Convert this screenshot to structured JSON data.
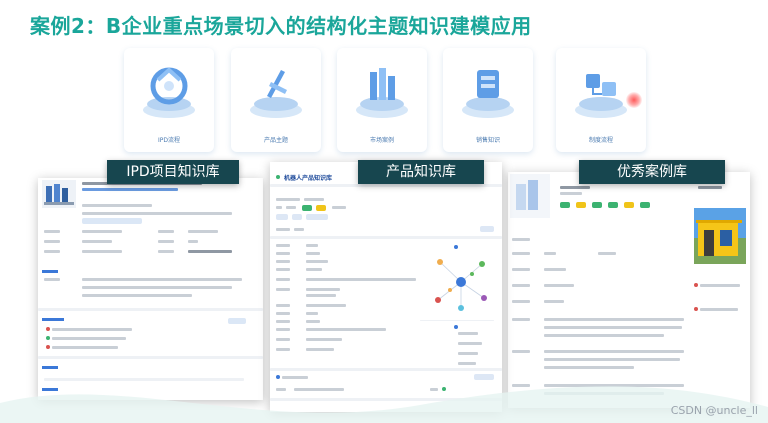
{
  "slide": {
    "title": "案例2：B企业重点场景切入的结构化主题知识建模应用"
  },
  "categories": [
    {
      "label": "IPD流程"
    },
    {
      "label": "产品主题"
    },
    {
      "label": "市场案例"
    },
    {
      "label": "销售知识"
    },
    {
      "label": "制度流程"
    }
  ],
  "banners": {
    "ipd": "IPD项目知识库",
    "product": "产品知识库",
    "cases": "优秀案例库"
  },
  "product_panel": {
    "title": "机器人产品知识库"
  },
  "colors": {
    "title": "#1aa69a",
    "banner_bg": "#17464f",
    "accent_blue": "#3b78d8",
    "tag_green": "#3cb371",
    "tag_yellow": "#f0c419"
  },
  "watermark": "CSDN @uncle_ll"
}
